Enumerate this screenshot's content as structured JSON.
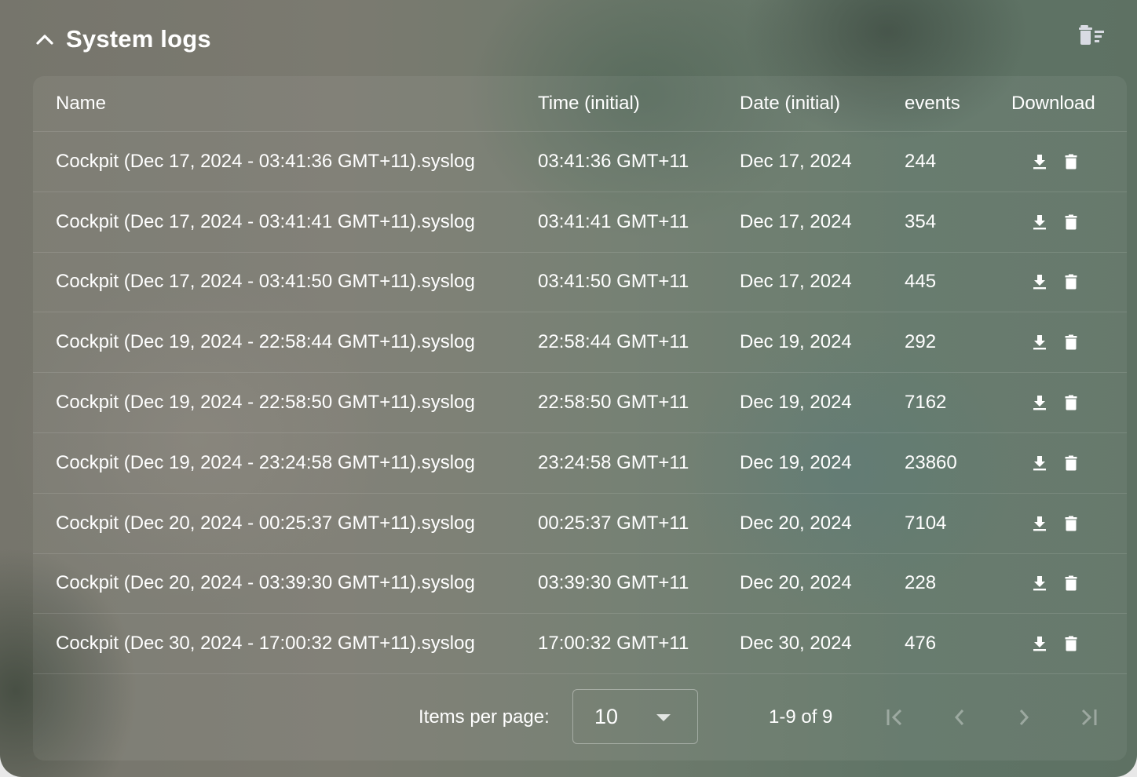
{
  "section": {
    "title": "System logs",
    "collapse_icon": "chevron-up-icon",
    "clear_all_icon": "delete-sweep-icon"
  },
  "table": {
    "columns": [
      "Name",
      "Time (initial)",
      "Date (initial)",
      "events",
      "Download"
    ],
    "rows": [
      {
        "name": "Cockpit (Dec 17, 2024 - 03:41:36 GMT+11).syslog",
        "time": "03:41:36 GMT+11",
        "date": "Dec 17, 2024",
        "events": "244"
      },
      {
        "name": "Cockpit (Dec 17, 2024 - 03:41:41 GMT+11).syslog",
        "time": "03:41:41 GMT+11",
        "date": "Dec 17, 2024",
        "events": "354"
      },
      {
        "name": "Cockpit (Dec 17, 2024 - 03:41:50 GMT+11).syslog",
        "time": "03:41:50 GMT+11",
        "date": "Dec 17, 2024",
        "events": "445"
      },
      {
        "name": "Cockpit (Dec 19, 2024 - 22:58:44 GMT+11).syslog",
        "time": "22:58:44 GMT+11",
        "date": "Dec 19, 2024",
        "events": "292"
      },
      {
        "name": "Cockpit (Dec 19, 2024 - 22:58:50 GMT+11).syslog",
        "time": "22:58:50 GMT+11",
        "date": "Dec 19, 2024",
        "events": "7162"
      },
      {
        "name": "Cockpit (Dec 19, 2024 - 23:24:58 GMT+11).syslog",
        "time": "23:24:58 GMT+11",
        "date": "Dec 19, 2024",
        "events": "23860"
      },
      {
        "name": "Cockpit (Dec 20, 2024 - 00:25:37 GMT+11).syslog",
        "time": "00:25:37 GMT+11",
        "date": "Dec 20, 2024",
        "events": "7104"
      },
      {
        "name": "Cockpit (Dec 20, 2024 - 03:39:30 GMT+11).syslog",
        "time": "03:39:30 GMT+11",
        "date": "Dec 20, 2024",
        "events": "228"
      },
      {
        "name": "Cockpit (Dec 30, 2024 - 17:00:32 GMT+11).syslog",
        "time": "17:00:32 GMT+11",
        "date": "Dec 30, 2024",
        "events": "476"
      }
    ],
    "row_actions": [
      "download-icon",
      "delete-icon"
    ]
  },
  "paginator": {
    "items_per_page_label": "Items per page:",
    "items_per_page_value": "10",
    "range_label": "1-9 of 9",
    "buttons": [
      "first-page",
      "previous-page",
      "next-page",
      "last-page"
    ]
  }
}
